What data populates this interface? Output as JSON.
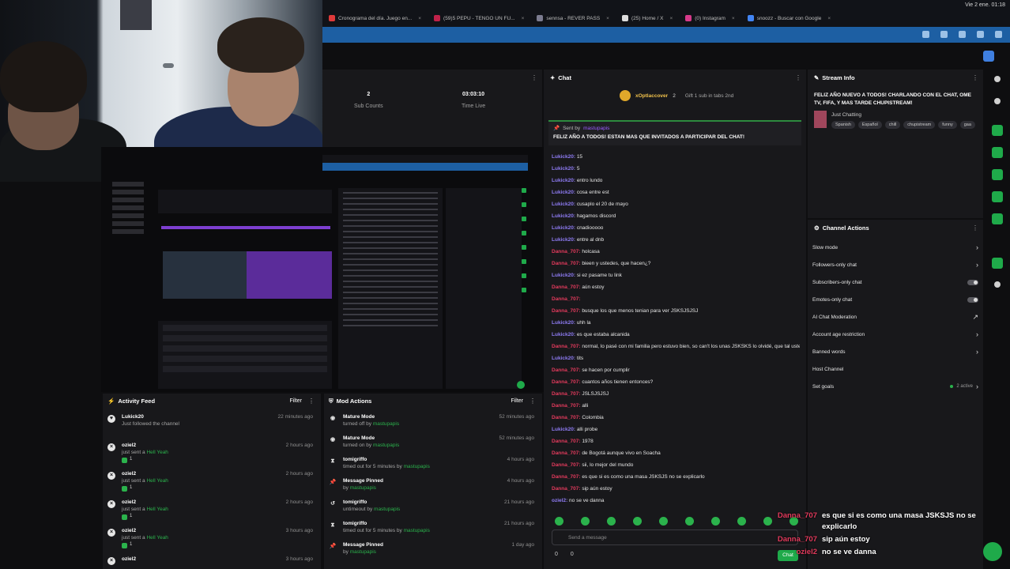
{
  "browser": {
    "tabs": [
      {
        "label": "Cronograma del día. Juego en...",
        "color": "#e03a3a"
      },
      {
        "label": "(59)5 PEPU - TENGO UN FU...",
        "color": "#c0224a"
      },
      {
        "label": "sennsa - REVER PASS",
        "color": "#7c7c90"
      },
      {
        "label": "(25) Home / X",
        "color": "#dddddd"
      },
      {
        "label": "(0) Instagram",
        "color": "#d63a8a"
      },
      {
        "label": "snoozz - Buscar con Google",
        "color": "#4285f4"
      }
    ],
    "clock": "Vie 2 ene. 01:18"
  },
  "stats": {
    "followers_value": "2",
    "followers_label": "Sub Counts",
    "time_value": "03:03:10",
    "time_label": "Time Live"
  },
  "chat": {
    "title": "Chat",
    "gift_user": "xOptlaccover",
    "gift_count": "2",
    "gift_text": "Gift 1 sub in tabs 2nd",
    "pinned_label": "Sent by",
    "pinned_sender": "mastupapis",
    "pinned_message": "FELIZ AÑO A TODOS! ESTAN MAS QUE INVITADOS A PARTICIPAR DEL CHAT!",
    "input_placeholder": "Send a message",
    "footer_points": "0",
    "footer_count": "0",
    "send_label": "Chat",
    "colors": {
      "lukick": "#8f7cf5",
      "danna": "#e23a5c",
      "oziel": "#8f7cf5"
    },
    "messages": [
      {
        "user": "Lukick20",
        "text": "15",
        "c": "lukick"
      },
      {
        "user": "Lukick20",
        "text": "5",
        "c": "lukick"
      },
      {
        "user": "Lukick20",
        "text": "entro lundo",
        "c": "lukick"
      },
      {
        "user": "Lukick20",
        "text": "cosa entre est",
        "c": "lukick"
      },
      {
        "user": "Lukick20",
        "text": "cusaplo el 20 de mayo",
        "c": "lukick"
      },
      {
        "user": "Lukick20",
        "text": "hagamos discord",
        "c": "lukick"
      },
      {
        "user": "Lukick20",
        "text": "cnadiooooo",
        "c": "lukick"
      },
      {
        "user": "Lukick20",
        "text": "entre al dnb",
        "c": "lukick"
      },
      {
        "user": "Danna_707",
        "text": "holcasa",
        "c": "danna"
      },
      {
        "user": "Danna_707",
        "text": "bieen y ustedes, que hacen¿?",
        "c": "danna"
      },
      {
        "user": "Lukick20",
        "text": "si ez pasame tu link",
        "c": "lukick"
      },
      {
        "user": "Danna_707",
        "text": "aún estoy",
        "c": "danna"
      },
      {
        "user": "Danna_707",
        "text": "",
        "c": "danna"
      },
      {
        "user": "Danna_707",
        "text": "busque los que menos tenian para ver JSKSJSJSJ",
        "c": "danna"
      },
      {
        "user": "Lukick20",
        "text": "uhh la",
        "c": "lukick"
      },
      {
        "user": "Lukick20",
        "text": "es que estaba alcanida",
        "c": "lukick"
      },
      {
        "user": "Danna_707",
        "text": "normal, lo pasé con mi familia pero estuvo bien, so can't los unas JSKSKS lo olvidé, que tal ustedes?",
        "c": "danna"
      },
      {
        "user": "Lukick20",
        "text": "tits",
        "c": "lukick"
      },
      {
        "user": "Danna_707",
        "text": "se hacen por cumplir",
        "c": "danna"
      },
      {
        "user": "Danna_707",
        "text": "cuantos años tienen entonces?",
        "c": "danna"
      },
      {
        "user": "Danna_707",
        "text": "JSLSJSJSJ",
        "c": "danna"
      },
      {
        "user": "Danna_707",
        "text": "alli",
        "c": "danna"
      },
      {
        "user": "Danna_707",
        "text": "Colombia",
        "c": "danna"
      },
      {
        "user": "Lukick20",
        "text": "alli probe",
        "c": "lukick"
      },
      {
        "user": "Danna_707",
        "text": "1978",
        "c": "danna"
      },
      {
        "user": "Danna_707",
        "text": "de Bogotá aunque vivo en Soacha",
        "c": "danna"
      },
      {
        "user": "Danna_707",
        "text": "sii, lo mejor del mundo",
        "c": "danna"
      },
      {
        "user": "Danna_707",
        "text": "es que si es como una masa JSKSJS no se explicarlo",
        "c": "danna"
      },
      {
        "user": "Danna_707",
        "text": "sip aún estoy",
        "c": "danna"
      },
      {
        "user": "oziel2",
        "text": "no se ve danna",
        "c": "oziel"
      }
    ]
  },
  "stream_info": {
    "title": "Stream Info",
    "stream_title": "FELIZ AÑO NUEVO A TODOS! CHARLANDO CON EL CHAT, OME TV, FIFA, Y MAS TARDE CHUPISTREAM!",
    "category": "Just Chatting",
    "tags": [
      "Spanish",
      "Español",
      "chill",
      "chupistream",
      "funny",
      "gaa"
    ]
  },
  "channel_actions": {
    "title": "Channel Actions",
    "items": [
      {
        "label": "Slow mode",
        "kind": "chevron"
      },
      {
        "label": "Followers-only chat",
        "kind": "chevron"
      },
      {
        "label": "Subscribers-only chat",
        "kind": "toggle"
      },
      {
        "label": "Emotes-only chat",
        "kind": "toggle"
      },
      {
        "label": "AI Chat Moderation",
        "kind": "external"
      },
      {
        "label": "Account age restriction",
        "kind": "chevron"
      },
      {
        "label": "Banned words",
        "kind": "chevron"
      },
      {
        "label": "Host Channel",
        "kind": "none"
      },
      {
        "label": "Set goals",
        "kind": "goals"
      }
    ],
    "goals_active": "2 active"
  },
  "activity_feed": {
    "title": "Activity Feed",
    "filter": "Filter",
    "items": [
      {
        "name": "Lukick20",
        "sub": "Just followed the channel",
        "ago": "22 minutes ago",
        "icon": "heart",
        "badge": ""
      },
      {
        "name": "oziel2",
        "sub": "just sent a",
        "hl": "Hell Yeah",
        "ago": "2 hours ago",
        "icon": "x",
        "badge": "1"
      },
      {
        "name": "oziel2",
        "sub": "just sent a",
        "hl": "Hell Yeah",
        "ago": "2 hours ago",
        "icon": "x",
        "badge": "1"
      },
      {
        "name": "oziel2",
        "sub": "just sent a",
        "hl": "Hell Yeah",
        "ago": "2 hours ago",
        "icon": "x",
        "badge": "1"
      },
      {
        "name": "oziel2",
        "sub": "just sent a",
        "hl": "Hell Yeah",
        "ago": "3 hours ago",
        "icon": "x",
        "badge": "1"
      },
      {
        "name": "oziel2",
        "sub": "",
        "hl": "",
        "ago": "3 hours ago",
        "icon": "x",
        "badge": ""
      }
    ]
  },
  "mod_actions": {
    "title": "Mod Actions",
    "filter": "Filter",
    "items": [
      {
        "name": "Mature Mode",
        "sub": "turned off by",
        "by": "mastupapis",
        "ago": "52 minutes ago",
        "icon": "eye"
      },
      {
        "name": "Mature Mode",
        "sub": "turned on by",
        "by": "mastupapis",
        "ago": "52 minutes ago",
        "icon": "eye"
      },
      {
        "name": "tomigriffo",
        "sub": "timed out for 5 minutes by",
        "by": "mastupapis",
        "ago": "4 hours ago",
        "icon": "hourglass"
      },
      {
        "name": "Message Pinned",
        "sub": "by",
        "by": "mastupapis",
        "ago": "4 hours ago",
        "icon": "pin"
      },
      {
        "name": "tomigriffo",
        "sub": "untimeout by",
        "by": "mastupapis",
        "ago": "21 hours ago",
        "icon": "undo"
      },
      {
        "name": "tomigriffo",
        "sub": "timed out for 5 minutes by",
        "by": "mastupapis",
        "ago": "21 hours ago",
        "icon": "hourglass"
      },
      {
        "name": "Message Pinned",
        "sub": "by",
        "by": "mastupapis",
        "ago": "1 day ago",
        "icon": "pin"
      }
    ]
  },
  "overlay": [
    {
      "user": "Danna_707",
      "text": "es que si es como una masa JSKSJS no se explicarlo"
    },
    {
      "user": "Danna_707",
      "text": "sip aún estoy"
    },
    {
      "user": "oziel2",
      "text": "no se ve danna"
    }
  ]
}
